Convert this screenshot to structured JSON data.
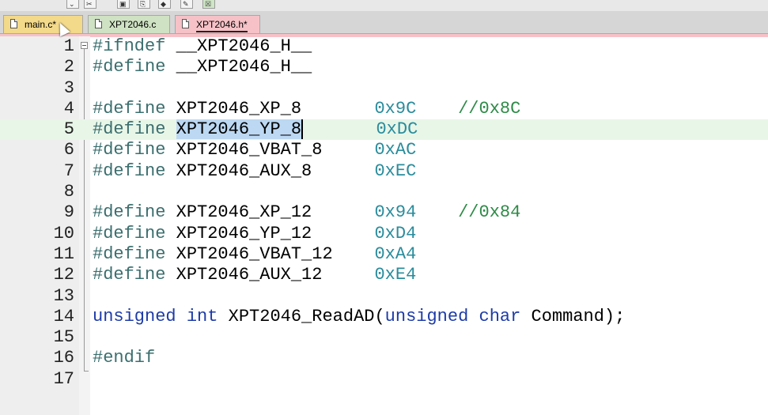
{
  "tabs": [
    {
      "label": "main.c*"
    },
    {
      "label": "XPT2046.c"
    },
    {
      "label": "XPT2046.h*"
    }
  ],
  "code_lines": [
    {
      "num": "1",
      "a": "#ifndef",
      "b": " __XPT2046_H__",
      "c": "",
      "d": ""
    },
    {
      "num": "2",
      "a": "#define",
      "b": " __XPT2046_H__",
      "c": "",
      "d": ""
    },
    {
      "num": "3",
      "a": "",
      "b": "",
      "c": "",
      "d": ""
    },
    {
      "num": "4",
      "a": "#define",
      "b": " XPT2046_XP_8       ",
      "c": "0x9C",
      "d": "    //0x8C"
    },
    {
      "num": "5",
      "a": "#define",
      "b": " ",
      "sel": "XPT2046_YP_8",
      "b2": "       ",
      "c": "0xDC",
      "d": ""
    },
    {
      "num": "6",
      "a": "#define",
      "b": " XPT2046_VBAT_8     ",
      "c": "0xAC",
      "d": ""
    },
    {
      "num": "7",
      "a": "#define",
      "b": " XPT2046_AUX_8      ",
      "c": "0xEC",
      "d": ""
    },
    {
      "num": "8",
      "a": "",
      "b": "",
      "c": "",
      "d": ""
    },
    {
      "num": "9",
      "a": "#define",
      "b": " XPT2046_XP_12      ",
      "c": "0x94",
      "d": "    //0x84"
    },
    {
      "num": "10",
      "a": "#define",
      "b": " XPT2046_YP_12      ",
      "c": "0xD4",
      "d": ""
    },
    {
      "num": "11",
      "a": "#define",
      "b": " XPT2046_VBAT_12    ",
      "c": "0xA4",
      "d": ""
    },
    {
      "num": "12",
      "a": "#define",
      "b": " XPT2046_AUX_12     ",
      "c": "0xE4",
      "d": ""
    },
    {
      "num": "13",
      "a": "",
      "b": "",
      "c": "",
      "d": ""
    },
    {
      "num": "14",
      "k1": "unsigned",
      "k2": "int",
      "f": " XPT2046_ReadAD(",
      "k3": "unsigned",
      "k4": "char",
      "g": " Command);"
    },
    {
      "num": "15",
      "a": "",
      "b": "",
      "c": "",
      "d": ""
    },
    {
      "num": "16",
      "a": "#endif",
      "b": "",
      "c": "",
      "d": ""
    },
    {
      "num": "17",
      "a": "",
      "b": "",
      "c": "",
      "d": ""
    }
  ]
}
